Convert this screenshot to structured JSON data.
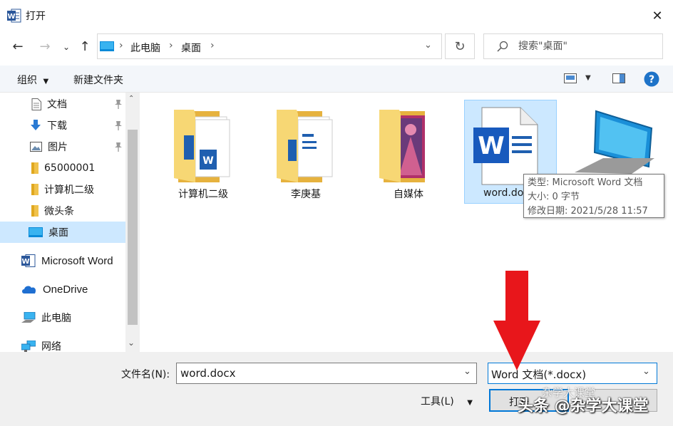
{
  "window": {
    "title": "打开"
  },
  "nav": {
    "breadcrumb": [
      "此电脑",
      "桌面"
    ],
    "search_placeholder": "搜索\"桌面\""
  },
  "toolbar": {
    "organize": "组织",
    "new_folder": "新建文件夹"
  },
  "sidebar": {
    "quick_access": [
      {
        "label": "文档",
        "pinned": true
      },
      {
        "label": "下载",
        "pinned": true
      },
      {
        "label": "图片",
        "pinned": true
      },
      {
        "label": "65000001",
        "pinned": false
      },
      {
        "label": "计算机二级",
        "pinned": false
      },
      {
        "label": "微头条",
        "pinned": false
      },
      {
        "label": "桌面",
        "pinned": false,
        "selected": true
      }
    ],
    "locations": [
      {
        "label": "Microsoft Word"
      },
      {
        "label": "OneDrive"
      },
      {
        "label": "此电脑"
      },
      {
        "label": "网络"
      }
    ]
  },
  "files": [
    {
      "name": "计算机二级",
      "type": "folder"
    },
    {
      "name": "李庚基",
      "type": "folder"
    },
    {
      "name": "自媒体",
      "type": "folder"
    },
    {
      "name": "word.do",
      "type": "word",
      "selected": true
    },
    {
      "name": "",
      "type": "computer"
    }
  ],
  "tooltip": {
    "lines": [
      "类型: Microsoft Word 文档",
      "大小: 0 字节",
      "修改日期: 2021/5/28 11:57"
    ]
  },
  "footer": {
    "filename_label": "文件名(N):",
    "filename_value": "word.docx",
    "filetype_value": "Word 文档(*.docx)",
    "tools_label": "工具(L)",
    "open_label": "打开"
  },
  "watermark": {
    "main": "头条 @杂学大课堂",
    "small": "杂学大课堂"
  },
  "colors": {
    "accent": "#0078d7",
    "selected_bg": "#cce8ff",
    "folder": "#f7d774",
    "arrow": "#e8161b",
    "word_blue": "#185abd"
  }
}
